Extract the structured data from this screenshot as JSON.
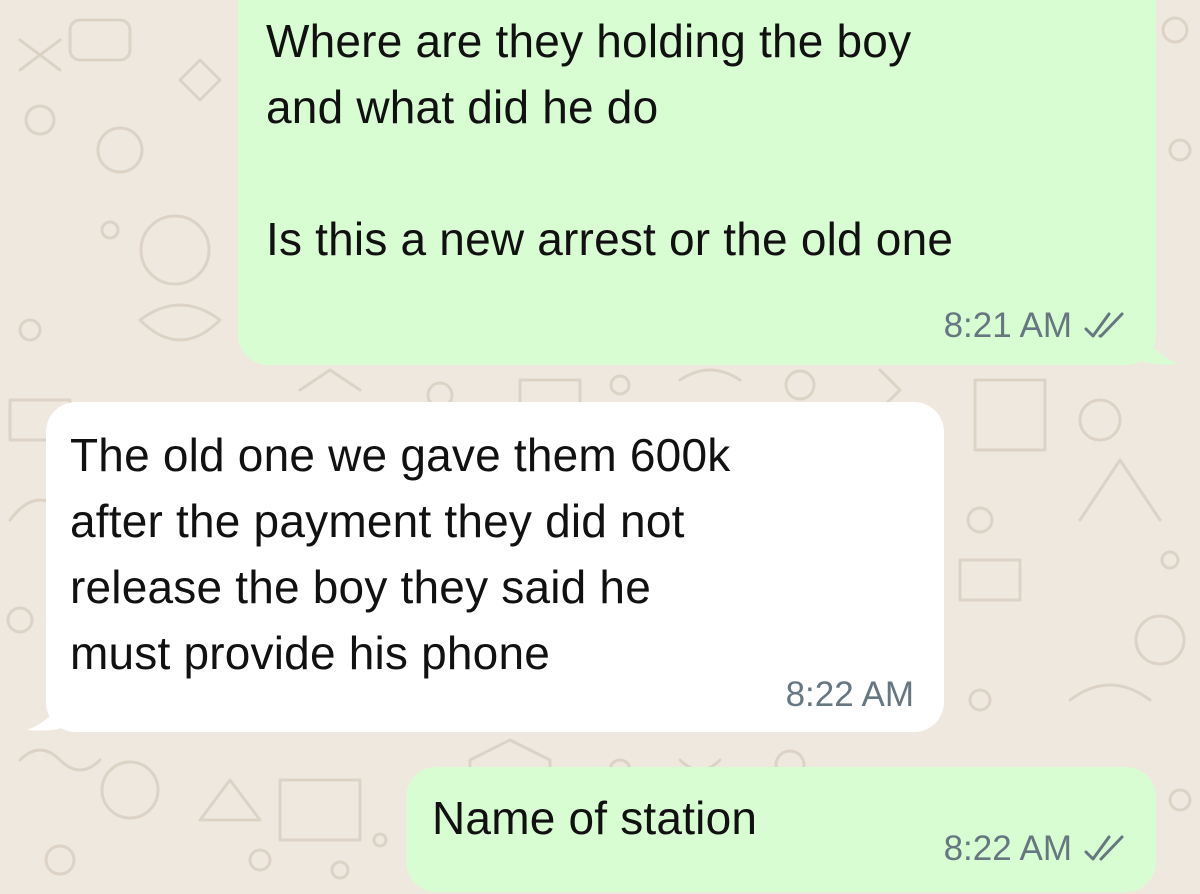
{
  "messages": [
    {
      "direction": "outgoing",
      "text": "Where are they holding the boy\nand what did he do\n\nIs this a new arrest or the old one",
      "time": "8:21 AM",
      "status_icon": "double-check-icon"
    },
    {
      "direction": "incoming",
      "text": "The old one we gave them 600k\nafter the payment they did not\nrelease the boy they said he\nmust provide his phone",
      "time": "8:22 AM"
    },
    {
      "direction": "outgoing",
      "text": "Name of station",
      "time": "8:22 AM",
      "status_icon": "double-check-icon"
    }
  ],
  "colors": {
    "background": "#efe8de",
    "outgoing_bubble": "#d9fdd3",
    "incoming_bubble": "#ffffff",
    "meta_text": "#667781"
  }
}
